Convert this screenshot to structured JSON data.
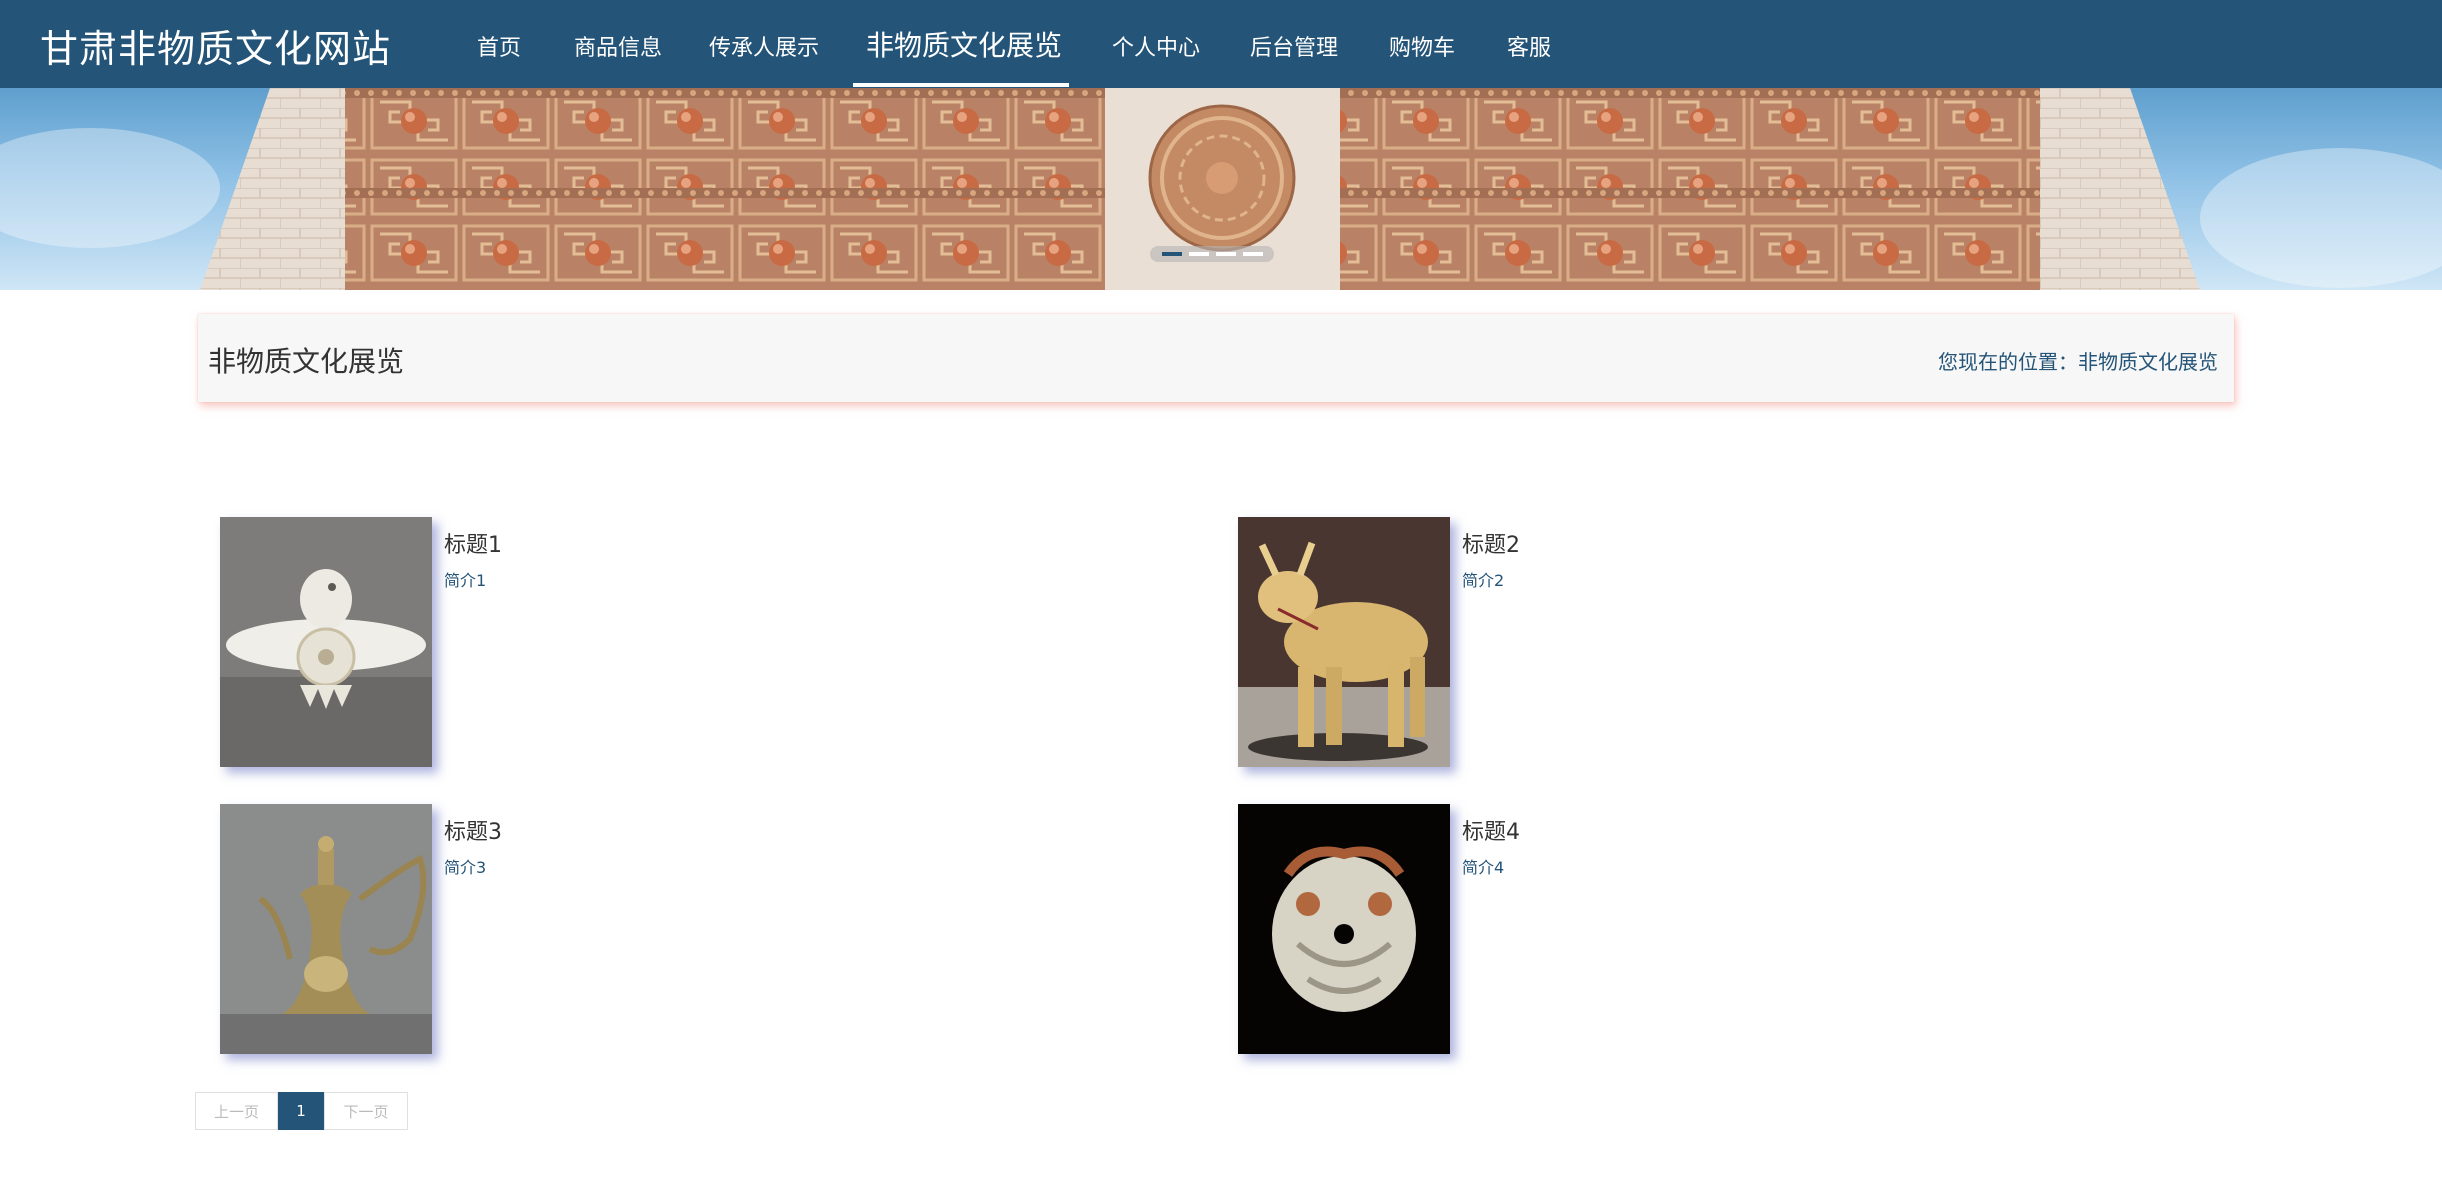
{
  "header": {
    "brand": "甘肃非物质文化网站",
    "nav": [
      {
        "label": "首页"
      },
      {
        "label": "商品信息"
      },
      {
        "label": "传承人展示"
      },
      {
        "label": "非物质文化展览",
        "active": true
      },
      {
        "label": "个人中心"
      },
      {
        "label": "后台管理"
      },
      {
        "label": "购物车"
      },
      {
        "label": "客服"
      }
    ]
  },
  "banner": {
    "slides": 4,
    "active_slide": 1
  },
  "page": {
    "title": "非物质文化展览",
    "breadcrumb_prefix": "您现在的位置：",
    "breadcrumb_current": "非物质文化展览"
  },
  "items": [
    {
      "title": "标题1",
      "desc": "简介1",
      "image": "white jade bird ornament"
    },
    {
      "title": "标题2",
      "desc": "简介2",
      "image": "ceramic ox figurine"
    },
    {
      "title": "标题3",
      "desc": "简介3",
      "image": "bronze ewer"
    },
    {
      "title": "标题4",
      "desc": "简介4",
      "image": "carved jade pendant"
    }
  ],
  "pagination": {
    "prev": "上一页",
    "current": "1",
    "next": "下一页"
  },
  "colors": {
    "primary": "#245478",
    "title_shadow": "#f0968c"
  }
}
